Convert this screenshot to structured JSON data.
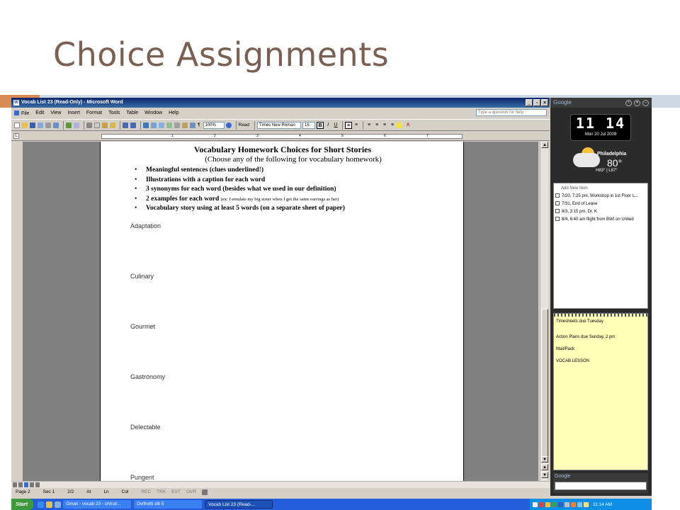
{
  "slide": {
    "title": "Choice Assignments"
  },
  "word": {
    "window_title": "Vocab List 23 (Read-Only) - Microsoft Word",
    "window_icon": "W",
    "title_controls": [
      "_",
      "▫",
      "×"
    ],
    "menus": [
      "File",
      "Edit",
      "View",
      "Insert",
      "Format",
      "Tools",
      "Table",
      "Window",
      "Help"
    ],
    "help_placeholder": "Type a question for help",
    "zoom": "100%",
    "read_label": "Read",
    "font_name": "Times New Roman",
    "font_size": "16",
    "bold_label": "B",
    "italic_label": "I",
    "underline_label": "U",
    "ruler_tab": "L",
    "ruler_numbers": [
      "1",
      "2",
      "3",
      "4",
      "5",
      "6",
      "7"
    ],
    "document": {
      "heading": "Vocabulary Homework Choices for Short Stories",
      "subheading": "(Choose any of the following for vocabulary homework)",
      "bullets": [
        "Meaningful sentences (clues underlined!)",
        "Illustrations with a caption for each word",
        "3 synonyms for each word (besides what we used in our definition)",
        "2 examples for each word",
        "Vocabulary story using at least 5 words (on a separate sheet of paper)"
      ],
      "example_note": "(ex: I emulate my big sister when I get the same earrings as her)",
      "words": [
        "Adaptation",
        "Culinary",
        "Gourmet",
        "Gastronomy",
        "Delectable",
        "Pungent"
      ]
    },
    "status": {
      "page": "Page 2",
      "sec": "Sec 1",
      "pages": "2/2",
      "at": "At",
      "ln": "Ln",
      "col": "Col",
      "rec": "REC",
      "trk": "TRK",
      "ext": "EXT",
      "ovr": "OVR"
    }
  },
  "sidebar": {
    "brand": "Google",
    "clock_time": "11 14",
    "clock_date": "Mon 20 Jul 2009",
    "weather_city": "Philadelphia",
    "weather_temp": "80°",
    "weather_hilo": "H83° | L67°",
    "todo_add": "Add New Item",
    "todo_items": [
      "7/20, 7:25 pm, Workshop in 1st Floor L...",
      "7/31, End of Lease",
      "8/3, 3:15 pm, Dr. K",
      "8/4, 6:40 am flight from BWI on United"
    ],
    "notes": [
      "Timesheets due Tuesday",
      "Action Plans due Sunday, 2 pm",
      "Mail/Pack",
      "VOCAB LESSON"
    ],
    "search_label": "Google"
  },
  "taskbar": {
    "start": "Start",
    "tasks": [
      "Gmail - vocab 23 - christi...",
      "Dvilhotti slit 5",
      "Vocab List 23 (Read-..."
    ],
    "time": "11:14 AM"
  }
}
